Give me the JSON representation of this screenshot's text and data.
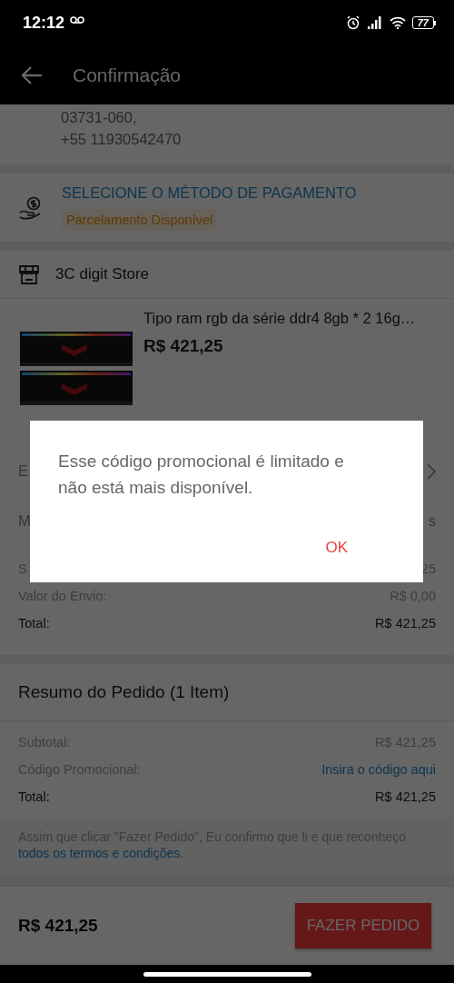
{
  "status_bar": {
    "time": "12:12",
    "battery": "77"
  },
  "header": {
    "title": "Confirmação"
  },
  "address": {
    "lines": [
      "03731-060,",
      "+55 11930542470"
    ]
  },
  "payment": {
    "title": "SELECIONE O MÉTODO DE PAGAMENTO",
    "badge": "Parcelamento Disponível"
  },
  "store": {
    "name": "3C digit Store"
  },
  "product": {
    "title": "Tipo ram rgb da série ddr4 8gb * 2 16g…",
    "price": "R$ 421,25"
  },
  "order_rows": [
    {
      "kind": "chevron",
      "label": "E"
    },
    {
      "kind": "plain",
      "label": "M",
      "value": "s"
    }
  ],
  "store_summary": [
    {
      "kind": "muted",
      "label": "S",
      "value": "25"
    },
    {
      "kind": "muted",
      "label": "Valor do Envio:",
      "value": "R$ 0,00"
    },
    {
      "kind": "total",
      "label": "Total:",
      "value": "R$ 421,25"
    }
  ],
  "summary": {
    "title": "Resumo do Pedido (1 Item)",
    "rows": [
      {
        "kind": "muted",
        "label": "Subtotal:",
        "value": "R$ 421,25"
      },
      {
        "kind": "link",
        "label": "Código Promocional:",
        "value": "Insira o código aqui"
      },
      {
        "kind": "total",
        "label": "Total:",
        "value": "R$ 421,25"
      }
    ]
  },
  "terms": {
    "text": "Assim que clicar \"Fazer Pedido\", Eu confirmo que li e que reconheço ",
    "link": "todos os termos e condições",
    "end": "."
  },
  "bottom_bar": {
    "total": "R$ 421,25",
    "button": "FAZER PEDIDO"
  },
  "dialog": {
    "message": "Esse código promocional é limitado e não está mais disponível.",
    "button": "OK"
  }
}
